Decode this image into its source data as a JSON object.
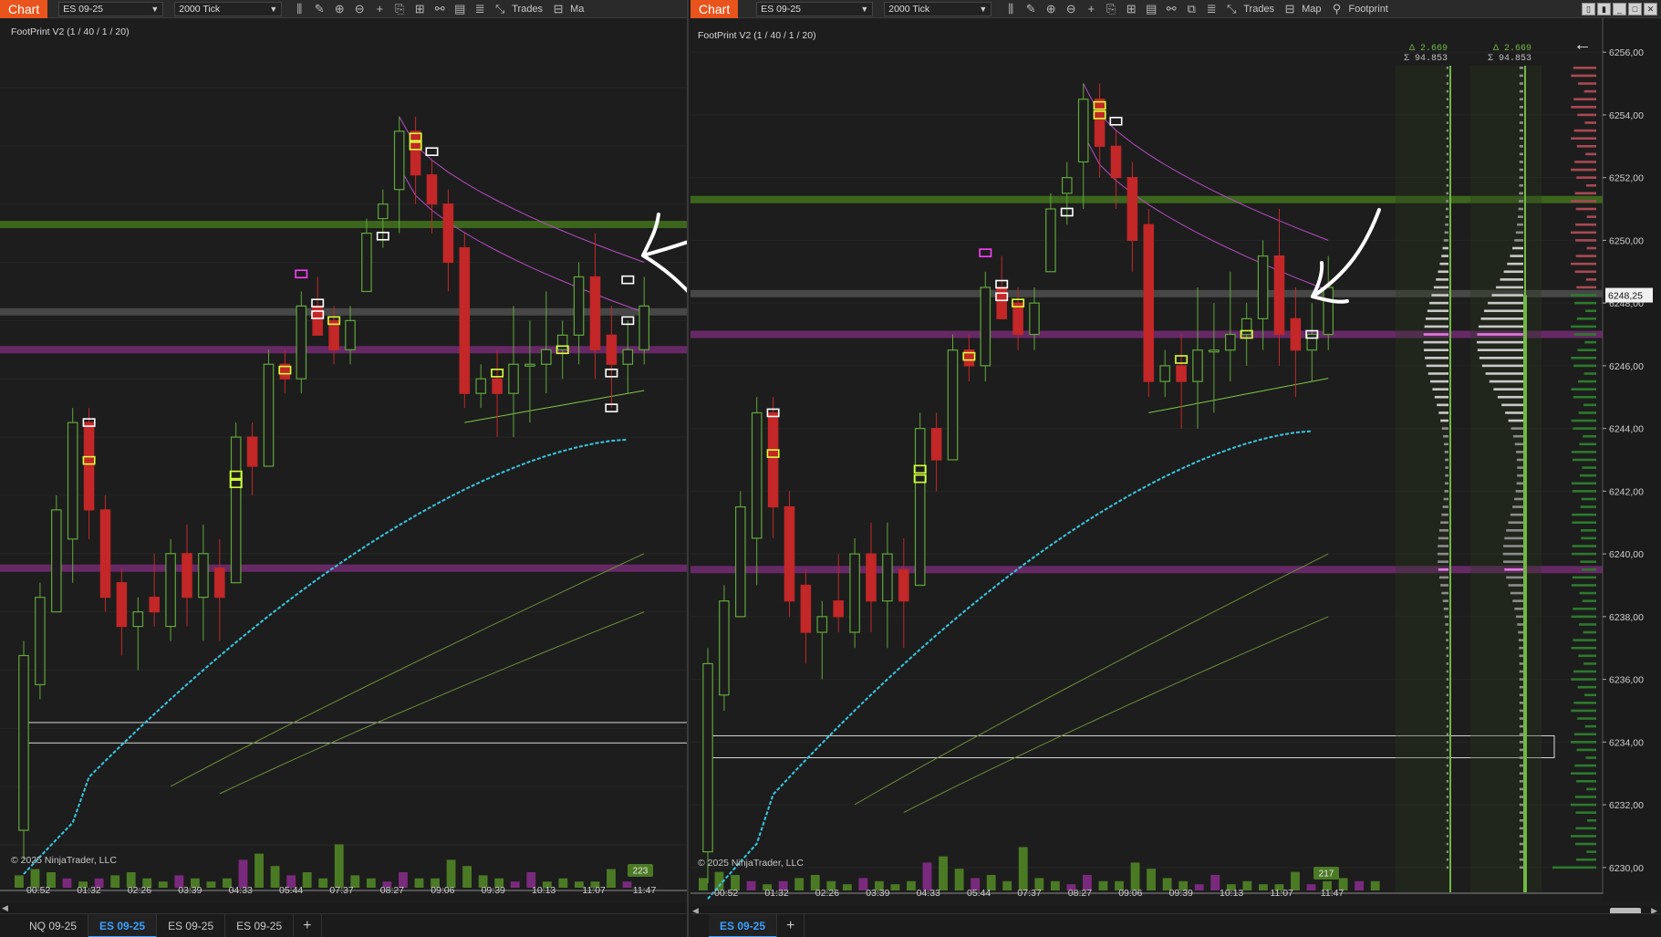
{
  "left_window": {
    "chart_tab": "Chart",
    "instrument": "ES 09-25",
    "interval": "2000 Tick",
    "toolbar_trades": "Trades",
    "toolbar_map_partial": "Ma",
    "chart_title": "FootPrint V2 (1 / 40 / 1 / 20)",
    "copyright": "© 2025 NinjaTrader, LLC",
    "volume_badge": "223",
    "time_labels": [
      "00:52",
      "01:32",
      "02:26",
      "03:39",
      "04:33",
      "05:44",
      "07:37",
      "08:27",
      "09:06",
      "09:39",
      "10:13",
      "11:07",
      "11:47"
    ],
    "bottom_tabs": [
      "NQ 09-25",
      "ES 09-25",
      "ES 09-25",
      "ES 09-25"
    ],
    "active_tab_index": 1
  },
  "right_window": {
    "chart_tab": "Chart",
    "instrument": "ES 09-25",
    "interval": "2000 Tick",
    "toolbar_trades": "Trades",
    "toolbar_map": "Map",
    "toolbar_footprint": "Footprint",
    "chart_title": "FootPrint V2 (1 / 40 / 1 / 20)",
    "copyright": "© 2025 NinjaTrader, LLC",
    "volume_badge": "217",
    "time_labels": [
      "00:52",
      "01:32",
      "02:26",
      "03:39",
      "04:33",
      "05:44",
      "07:37",
      "08:27",
      "09:06",
      "09:39",
      "10:13",
      "11:07",
      "11:47"
    ],
    "price_labels": [
      "6256,00",
      "6254,00",
      "6252,00",
      "6250,00",
      "6248,00",
      "6246,00",
      "6244,00",
      "6242,00",
      "6240,00",
      "6238,00",
      "6236,00",
      "6234,00",
      "6232,00",
      "6230,00"
    ],
    "current_price": "6248,25",
    "profile_1_delta": "Δ 2.669",
    "profile_1_sigma": "Σ 94.853",
    "profile_2_delta": "Δ 2.669",
    "profile_2_sigma": "Σ 94.853",
    "bottom_tabs": [
      "ES 09-25"
    ],
    "active_tab_index": 0
  },
  "colors": {
    "up_candle": "#5fa83a",
    "down_candle": "#c32727",
    "vwap": "#38c7e0",
    "green_level": "#3e6a1c",
    "purple_level": "#6a2a6a",
    "gray_level": "#4a4a4a",
    "purple_band_line": "#b84cc4",
    "green_band_line": "#7fc64a",
    "accent_orange": "#e8541c"
  },
  "chart_data": {
    "type": "candlestick",
    "instrument": "ES 09-25",
    "bar_type": "2000 Tick",
    "y_range": [
      6229.5,
      6256.5
    ],
    "candles": [
      {
        "o": 6230.5,
        "h": 6237.0,
        "l": 6229.5,
        "c": 6236.5
      },
      {
        "o": 6235.5,
        "h": 6239.0,
        "l": 6235.0,
        "c": 6238.5
      },
      {
        "o": 6238.0,
        "h": 6242.0,
        "l": 6238.0,
        "c": 6241.5
      },
      {
        "o": 6240.5,
        "h": 6245.0,
        "l": 6239.0,
        "c": 6244.5
      },
      {
        "o": 6244.5,
        "h": 6245.0,
        "l": 6240.5,
        "c": 6241.5
      },
      {
        "o": 6241.5,
        "h": 6242.0,
        "l": 6238.0,
        "c": 6238.5
      },
      {
        "o": 6239.0,
        "h": 6239.5,
        "l": 6236.5,
        "c": 6237.5
      },
      {
        "o": 6237.5,
        "h": 6238.5,
        "l": 6236.0,
        "c": 6238.0
      },
      {
        "o": 6238.5,
        "h": 6240.0,
        "l": 6237.5,
        "c": 6238.0
      },
      {
        "o": 6237.5,
        "h": 6240.5,
        "l": 6237.0,
        "c": 6240.0
      },
      {
        "o": 6240.0,
        "h": 6241.0,
        "l": 6237.5,
        "c": 6238.5
      },
      {
        "o": 6238.5,
        "h": 6241.0,
        "l": 6237.0,
        "c": 6240.0
      },
      {
        "o": 6239.5,
        "h": 6240.5,
        "l": 6237.0,
        "c": 6238.5
      },
      {
        "o": 6239.0,
        "h": 6244.5,
        "l": 6239.0,
        "c": 6244.0
      },
      {
        "o": 6244.0,
        "h": 6244.5,
        "l": 6242.0,
        "c": 6243.0
      },
      {
        "o": 6243.0,
        "h": 6247.0,
        "l": 6243.0,
        "c": 6246.5
      },
      {
        "o": 6246.5,
        "h": 6247.0,
        "l": 6245.5,
        "c": 6246.0
      },
      {
        "o": 6246.0,
        "h": 6249.0,
        "l": 6245.5,
        "c": 6248.5
      },
      {
        "o": 6248.5,
        "h": 6249.5,
        "l": 6247.5,
        "c": 6247.5
      },
      {
        "o": 6248.0,
        "h": 6248.5,
        "l": 6246.5,
        "c": 6247.0
      },
      {
        "o": 6247.0,
        "h": 6248.5,
        "l": 6246.5,
        "c": 6248.0
      },
      {
        "o": 6249.0,
        "h": 6251.5,
        "l": 6249.0,
        "c": 6251.0
      },
      {
        "o": 6251.5,
        "h": 6252.5,
        "l": 6250.5,
        "c": 6252.0
      },
      {
        "o": 6252.5,
        "h": 6255.0,
        "l": 6251.0,
        "c": 6254.5
      },
      {
        "o": 6254.5,
        "h": 6255.0,
        "l": 6252.0,
        "c": 6253.0
      },
      {
        "o": 6253.0,
        "h": 6253.5,
        "l": 6251.0,
        "c": 6252.0
      },
      {
        "o": 6252.0,
        "h": 6252.5,
        "l": 6249.0,
        "c": 6250.0
      },
      {
        "o": 6250.5,
        "h": 6251.0,
        "l": 6245.0,
        "c": 6245.5
      },
      {
        "o": 6245.5,
        "h": 6246.5,
        "l": 6245.0,
        "c": 6246.0
      },
      {
        "o": 6246.0,
        "h": 6247.0,
        "l": 6244.0,
        "c": 6245.5
      },
      {
        "o": 6245.5,
        "h": 6248.5,
        "l": 6244.0,
        "c": 6246.5
      },
      {
        "o": 6246.5,
        "h": 6248.0,
        "l": 6244.5,
        "c": 6246.5
      },
      {
        "o": 6246.5,
        "h": 6249.0,
        "l": 6245.5,
        "c": 6247.0
      },
      {
        "o": 6247.0,
        "h": 6248.0,
        "l": 6246.0,
        "c": 6247.5
      },
      {
        "o": 6247.5,
        "h": 6250.0,
        "l": 6246.5,
        "c": 6249.5
      },
      {
        "o": 6249.5,
        "h": 6251.0,
        "l": 6246.0,
        "c": 6247.0
      },
      {
        "o": 6247.5,
        "h": 6248.5,
        "l": 6245.0,
        "c": 6246.5
      },
      {
        "o": 6246.5,
        "h": 6248.0,
        "l": 6245.5,
        "c": 6247.0
      },
      {
        "o": 6247.0,
        "h": 6249.5,
        "l": 6246.5,
        "c": 6248.5
      }
    ],
    "levels": [
      {
        "price": 6251.3,
        "kind": "green"
      },
      {
        "price": 6248.3,
        "kind": "gray"
      },
      {
        "price": 6247.0,
        "kind": "purple"
      },
      {
        "price": 6239.5,
        "kind": "purple"
      }
    ],
    "box_zone": [
      6233.5,
      6234.2
    ],
    "volume": [
      4,
      6,
      5,
      3,
      2,
      3,
      4,
      5,
      3,
      2,
      4,
      3,
      2,
      3,
      9,
      11,
      7,
      4,
      5,
      3,
      14,
      4,
      3,
      2,
      5,
      3,
      3,
      9,
      7,
      4,
      3,
      2,
      5,
      2,
      3,
      2,
      2,
      6,
      2,
      3,
      4,
      3,
      3
    ]
  }
}
